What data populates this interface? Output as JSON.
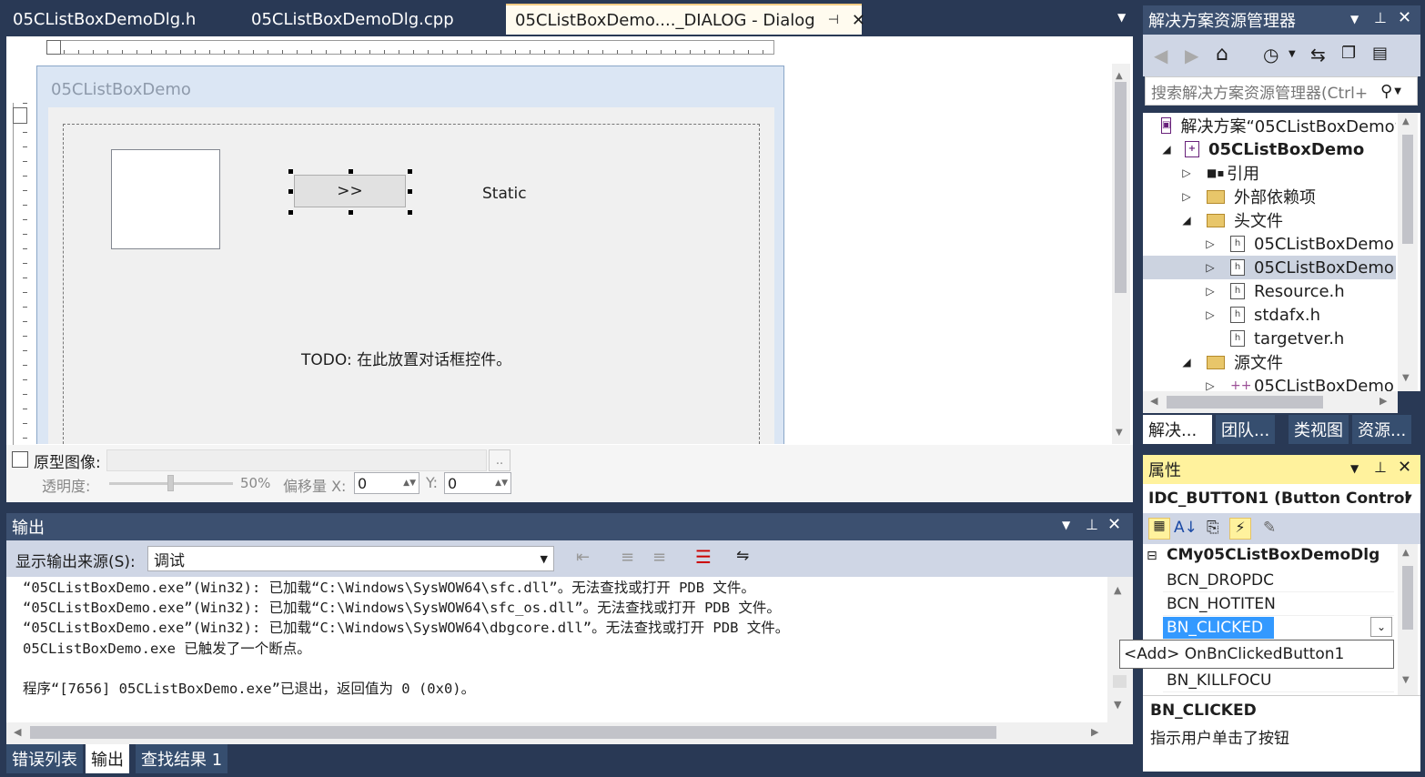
{
  "doc_tabs": [
    {
      "label": "05CListBoxDemoDlg.h",
      "active": false
    },
    {
      "label": "05CListBoxDemoDlg.cpp",
      "active": false
    },
    {
      "label": "05CListBoxDemo...._DIALOG - Dialog",
      "active": true
    }
  ],
  "dialog": {
    "title": "05CListBoxDemo",
    "button_label": ">>",
    "static_label": "Static",
    "todo_label": "TODO: 在此放置对话框控件。"
  },
  "prototype": {
    "checkbox_label": "原型图像:",
    "browse_label": "..",
    "opacity_label": "透明度:",
    "opacity_value": "50%",
    "offset_x_label": "偏移量 X:",
    "offset_x_value": "0",
    "offset_y_label": "Y:",
    "offset_y_value": "0"
  },
  "output": {
    "title": "输出",
    "source_label": "显示输出来源(S):",
    "source_value": "调试",
    "lines": [
      "“05CListBoxDemo.exe”(Win32): 已加载“C:\\Windows\\SysWOW64\\sfc.dll”。无法查找或打开 PDB 文件。",
      "“05CListBoxDemo.exe”(Win32): 已加载“C:\\Windows\\SysWOW64\\sfc_os.dll”。无法查找或打开 PDB 文件。",
      "“05CListBoxDemo.exe”(Win32): 已加载“C:\\Windows\\SysWOW64\\dbgcore.dll”。无法查找或打开 PDB 文件。",
      "05CListBoxDemo.exe 已触发了一个断点。",
      "",
      "程序“[7656] 05CListBoxDemo.exe”已退出，返回值为 0 (0x0)。"
    ]
  },
  "bottom_tabs": [
    {
      "label": "错误列表",
      "active": false
    },
    {
      "label": "输出",
      "active": true
    },
    {
      "label": "查找结果 1",
      "active": false
    }
  ],
  "solution_explorer": {
    "title": "解决方案资源管理器",
    "search_placeholder": "搜索解决方案资源管理器(Ctrl+",
    "items": [
      {
        "label": "解决方案“05CListBoxDemo”",
        "bold": false,
        "indent": 0,
        "arrow": ""
      },
      {
        "label": "05CListBoxDemo",
        "bold": true,
        "indent": 1,
        "arrow": "◢"
      },
      {
        "label": "引用",
        "bold": false,
        "indent": 2,
        "arrow": "▷"
      },
      {
        "label": "外部依赖项",
        "bold": false,
        "indent": 2,
        "arrow": "▷"
      },
      {
        "label": "头文件",
        "bold": false,
        "indent": 2,
        "arrow": "◢"
      },
      {
        "label": "05CListBoxDemo",
        "bold": false,
        "indent": 3,
        "arrow": "▷"
      },
      {
        "label": "05CListBoxDemo",
        "bold": false,
        "indent": 3,
        "arrow": "▷",
        "selected": true
      },
      {
        "label": "Resource.h",
        "bold": false,
        "indent": 3,
        "arrow": "▷"
      },
      {
        "label": "stdafx.h",
        "bold": false,
        "indent": 3,
        "arrow": "▷"
      },
      {
        "label": "targetver.h",
        "bold": false,
        "indent": 3,
        "arrow": ""
      },
      {
        "label": "源文件",
        "bold": false,
        "indent": 2,
        "arrow": "◢"
      },
      {
        "label": "05CListBoxDemo",
        "bold": false,
        "indent": 3,
        "arrow": "▷"
      }
    ],
    "tabs": [
      "解决...",
      "团队...",
      "类视图",
      "资源..."
    ]
  },
  "properties": {
    "title": "属性",
    "object": "IDC_BUTTON1 (Button Control",
    "class_name": "CMy05CListBoxDemoDlg",
    "rows": [
      "BCN_DROPDC",
      "BCN_HOTITEN",
      "BN_CLICKED",
      "BN_KILLFOCU"
    ],
    "dropdown_option": "<Add> OnBnClickedButton1",
    "desc_title": "BN_CLICKED",
    "desc_text": "指示用户单击了按钮"
  },
  "colors": {
    "chrome": "#293955",
    "active_tab": "#fffbef",
    "panel_active": "#fff29d",
    "selection": "#3399ff"
  }
}
